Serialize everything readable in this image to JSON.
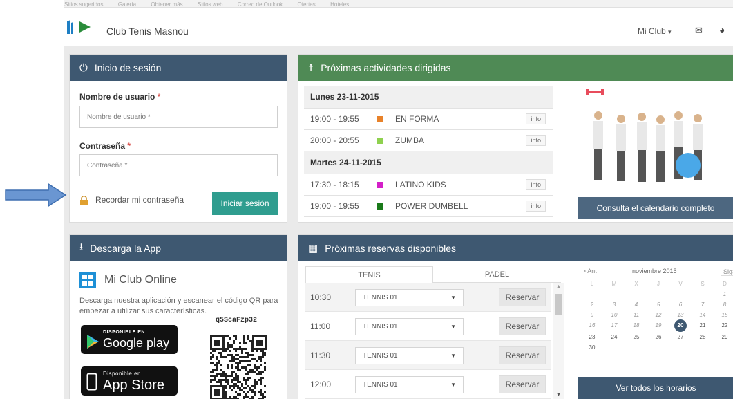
{
  "browser_bookmarks": [
    "Sitios sugeridos",
    "Galería",
    "Obtener más",
    "Sitios web",
    "Correo de Outlook",
    "Ofertas",
    "Hoteles"
  ],
  "header": {
    "club_name": "Club Tenis Masnou",
    "menu_label": "Mi Club",
    "menu_caret": "▾",
    "mail_icon": "envelope-icon",
    "globe_icon": "globe-icon"
  },
  "login": {
    "title": "Inicio de sesión",
    "username_label": "Nombre de usuario",
    "username_placeholder": "Nombre de usuario *",
    "password_label": "Contraseña",
    "password_placeholder": "Contraseña *",
    "required_mark": "*",
    "remember_label": "Recordar mi contraseña",
    "submit_label": "Iniciar sesión"
  },
  "app": {
    "title": "Descarga la App",
    "product_name": "Mi Club Online",
    "description": "Descarga nuestra aplicación y escanear el código QR para empezar a utilizar sus características.",
    "code": "q5ScaFzp32",
    "google_small": "DISPONIBLE EN",
    "google_big": "Google play",
    "apple_small": "Disponible en",
    "apple_big": "App Store"
  },
  "activities": {
    "title": "Próximas actividades dirigidas",
    "days": [
      {
        "label": "Lunes 23-11-2015",
        "items": [
          {
            "time": "19:00 - 19:55",
            "name": "EN FORMA",
            "color": "#e8822a",
            "info": "info"
          },
          {
            "time": "20:00 - 20:55",
            "name": "ZUMBA",
            "color": "#8fd14f",
            "info": "info"
          }
        ]
      },
      {
        "label": "Martes 24-11-2015",
        "items": [
          {
            "time": "17:30 - 18:15",
            "name": "LATINO KIDS",
            "color": "#d41fc8",
            "info": "info"
          },
          {
            "time": "19:00 - 19:55",
            "name": "POWER DUMBELL",
            "color": "#1a7a1a",
            "info": "info"
          }
        ]
      }
    ],
    "calendar_button": "Consulta el calendario completo"
  },
  "reservations": {
    "title": "Próximas reservas disponibles",
    "tabs": [
      "TENIS",
      "PADEL"
    ],
    "rows": [
      {
        "time": "10:30",
        "court": "TENNIS 01",
        "action": "Reservar"
      },
      {
        "time": "11:00",
        "court": "TENNIS 01",
        "action": "Reservar"
      },
      {
        "time": "11:30",
        "court": "TENNIS 01",
        "action": "Reservar"
      },
      {
        "time": "12:00",
        "court": "TENNIS 01",
        "action": "Reservar"
      }
    ],
    "calendar": {
      "prev": "<Ant",
      "month": "noviembre 2015",
      "next": "Sig>",
      "weekdays": [
        "L",
        "M",
        "X",
        "J",
        "V",
        "S",
        "D"
      ],
      "today": "20"
    },
    "all_button": "Ver todos los horarios"
  }
}
